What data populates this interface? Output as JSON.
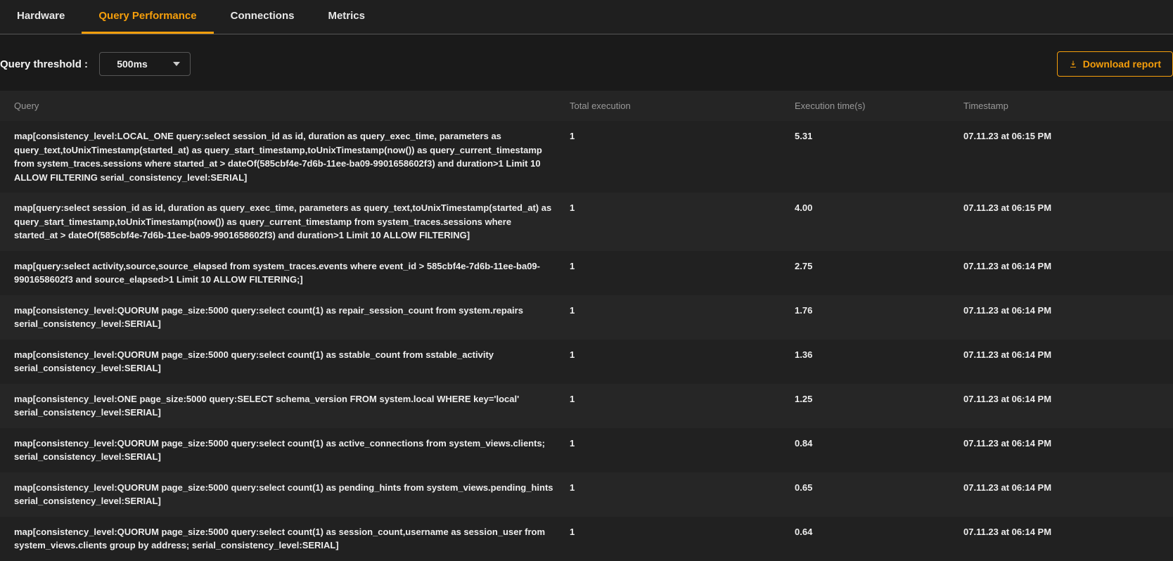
{
  "tabs": [
    {
      "label": "Hardware",
      "active": false
    },
    {
      "label": "Query Performance",
      "active": true
    },
    {
      "label": "Connections",
      "active": false
    },
    {
      "label": "Metrics",
      "active": false
    }
  ],
  "threshold": {
    "label": "Query threshold :",
    "value": "500ms"
  },
  "download_btn": {
    "label": "Download report"
  },
  "table": {
    "headers": {
      "query": "Query",
      "total": "Total execution",
      "time": "Execution time(s)",
      "timestamp": "Timestamp"
    },
    "rows": [
      {
        "query": "map[consistency_level:LOCAL_ONE query:select session_id as id, duration as query_exec_time, parameters as query_text,toUnixTimestamp(started_at) as query_start_timestamp,toUnixTimestamp(now()) as query_current_timestamp from system_traces.sessions where started_at > dateOf(585cbf4e-7d6b-11ee-ba09-9901658602f3) and duration>1 Limit 10 ALLOW FILTERING serial_consistency_level:SERIAL]",
        "total": "1",
        "time": "5.31",
        "timestamp": "07.11.23 at 06:15 PM"
      },
      {
        "query": "map[query:select session_id as id, duration as query_exec_time, parameters as query_text,toUnixTimestamp(started_at) as query_start_timestamp,toUnixTimestamp(now()) as query_current_timestamp from system_traces.sessions where started_at > dateOf(585cbf4e-7d6b-11ee-ba09-9901658602f3) and duration>1 Limit 10 ALLOW FILTERING]",
        "total": "1",
        "time": "4.00",
        "timestamp": "07.11.23 at 06:15 PM"
      },
      {
        "query": "map[query:select activity,source,source_elapsed from system_traces.events where event_id > 585cbf4e-7d6b-11ee-ba09-9901658602f3 and source_elapsed>1 Limit 10 ALLOW FILTERING;]",
        "total": "1",
        "time": "2.75",
        "timestamp": "07.11.23 at 06:14 PM"
      },
      {
        "query": "map[consistency_level:QUORUM page_size:5000 query:select count(1) as repair_session_count from system.repairs serial_consistency_level:SERIAL]",
        "total": "1",
        "time": "1.76",
        "timestamp": "07.11.23 at 06:14 PM"
      },
      {
        "query": "map[consistency_level:QUORUM page_size:5000 query:select count(1) as sstable_count from sstable_activity serial_consistency_level:SERIAL]",
        "total": "1",
        "time": "1.36",
        "timestamp": "07.11.23 at 06:14 PM"
      },
      {
        "query": "map[consistency_level:ONE page_size:5000 query:SELECT schema_version FROM system.local WHERE key='local' serial_consistency_level:SERIAL]",
        "total": "1",
        "time": "1.25",
        "timestamp": "07.11.23 at 06:14 PM"
      },
      {
        "query": "map[consistency_level:QUORUM page_size:5000 query:select count(1) as active_connections from system_views.clients; serial_consistency_level:SERIAL]",
        "total": "1",
        "time": "0.84",
        "timestamp": "07.11.23 at 06:14 PM"
      },
      {
        "query": "map[consistency_level:QUORUM page_size:5000 query:select count(1) as pending_hints from system_views.pending_hints serial_consistency_level:SERIAL]",
        "total": "1",
        "time": "0.65",
        "timestamp": "07.11.23 at 06:14 PM"
      },
      {
        "query": "map[consistency_level:QUORUM page_size:5000 query:select count(1) as session_count,username as session_user from system_views.clients group by address; serial_consistency_level:SERIAL]",
        "total": "1",
        "time": "0.64",
        "timestamp": "07.11.23 at 06:14 PM"
      }
    ]
  }
}
